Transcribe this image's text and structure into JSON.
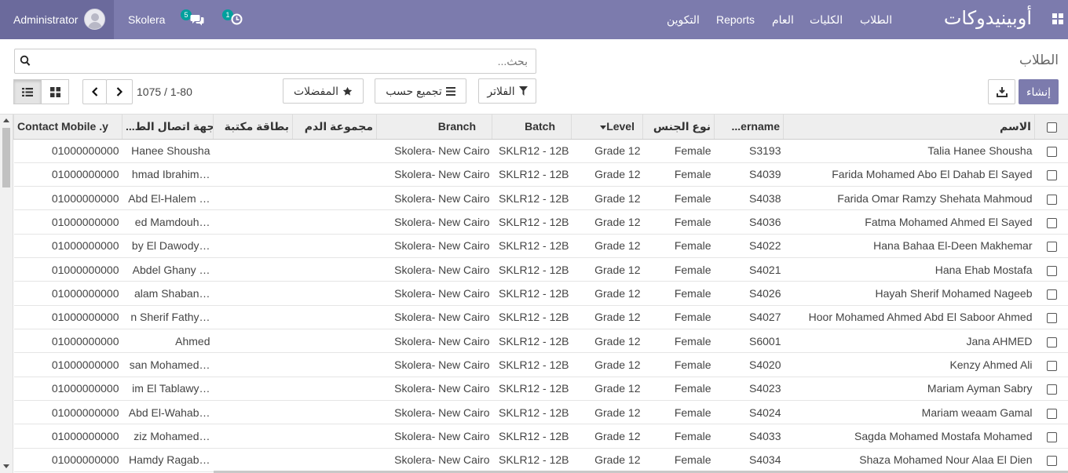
{
  "navbar": {
    "user": "Administrator",
    "company": "Skolera",
    "messages_count": "5",
    "activities_count": "1",
    "menu": [
      "التكوين",
      "Reports",
      "العام",
      "الكليات",
      "الطلاب"
    ],
    "brand": "أوبينيدوكات"
  },
  "control_panel": {
    "title": "الطلاب",
    "search_placeholder": "بحث...",
    "create_label": "إنشاء",
    "filters_label": "الفلاتر",
    "group_by_label": "تجميع حسب",
    "favorites_label": "المفضلات",
    "pager_value": "1-80",
    "pager_sep": "/",
    "pager_total": "1075"
  },
  "table": {
    "columns": {
      "name": "الاسم",
      "username": "...ername",
      "gender": "نوع الجنس",
      "level": "Level",
      "batch": "Batch",
      "branch": "Branch",
      "blood_group": "مجموعة الدم",
      "library_card": "بطاقة مكتبة",
      "emergency_contact": "...جهة اتصال الط",
      "emergency_mobile": "Contact Mobile .y"
    },
    "rows": [
      {
        "name": "Talia Hanee Shousha",
        "username": "S3193",
        "gender": "Female",
        "level": "Grade 12",
        "batch": "SKLR12 - 12B",
        "branch": "Skolera- New Cairo",
        "contact": "Hanee Shousha",
        "mobile": "01000000000"
      },
      {
        "name": "Farida Mohamed Abo El Dahab El Sayed",
        "username": "S4039",
        "gender": "Female",
        "level": "Grade 12",
        "batch": "SKLR12 - 12B",
        "branch": "Skolera- New Cairo",
        "contact": "hmad Ibrahim…",
        "mobile": "01000000000"
      },
      {
        "name": "Farida Omar Ramzy Shehata Mahmoud",
        "username": "S4038",
        "gender": "Female",
        "level": "Grade 12",
        "batch": "SKLR12 - 12B",
        "branch": "Skolera- New Cairo",
        "contact": "Abd El-Halem …",
        "mobile": "01000000000"
      },
      {
        "name": "Fatma Mohamed Ahmed El Sayed",
        "username": "S4036",
        "gender": "Female",
        "level": "Grade 12",
        "batch": "SKLR12 - 12B",
        "branch": "Skolera- New Cairo",
        "contact": "ed Mamdouh…",
        "mobile": "01000000000"
      },
      {
        "name": "Hana Bahaa El-Deen Makhemar",
        "username": "S4022",
        "gender": "Female",
        "level": "Grade 12",
        "batch": "SKLR12 - 12B",
        "branch": "Skolera- New Cairo",
        "contact": "by El Dawody…",
        "mobile": "01000000000"
      },
      {
        "name": "Hana Ehab Mostafa",
        "username": "S4021",
        "gender": "Female",
        "level": "Grade 12",
        "batch": "SKLR12 - 12B",
        "branch": "Skolera- New Cairo",
        "contact": "Abdel Ghany …",
        "mobile": "01000000000"
      },
      {
        "name": "Hayah Sherif Mohamed Nageeb",
        "username": "S4026",
        "gender": "Female",
        "level": "Grade 12",
        "batch": "SKLR12 - 12B",
        "branch": "Skolera- New Cairo",
        "contact": "alam Shaban…",
        "mobile": "01000000000"
      },
      {
        "name": "Hoor Mohamed Ahmed Abd El Saboor Ahmed",
        "username": "S4027",
        "gender": "Female",
        "level": "Grade 12",
        "batch": "SKLR12 - 12B",
        "branch": "Skolera- New Cairo",
        "contact": "n Sherif Fathy…",
        "mobile": "01000000000"
      },
      {
        "name": "Jana AHMED",
        "username": "S6001",
        "gender": "Female",
        "level": "Grade 12",
        "batch": "SKLR12 - 12B",
        "branch": "Skolera- New Cairo",
        "contact": "Ahmed",
        "mobile": "01000000000"
      },
      {
        "name": "Kenzy Ahmed Ali",
        "username": "S4020",
        "gender": "Female",
        "level": "Grade 12",
        "batch": "SKLR12 - 12B",
        "branch": "Skolera- New Cairo",
        "contact": "san Mohamed…",
        "mobile": "01000000000"
      },
      {
        "name": "Mariam Ayman Sabry",
        "username": "S4023",
        "gender": "Female",
        "level": "Grade 12",
        "batch": "SKLR12 - 12B",
        "branch": "Skolera- New Cairo",
        "contact": "im El Tablawy…",
        "mobile": "01000000000"
      },
      {
        "name": "Mariam weaam Gamal",
        "username": "S4024",
        "gender": "Female",
        "level": "Grade 12",
        "batch": "SKLR12 - 12B",
        "branch": "Skolera- New Cairo",
        "contact": "Abd El-Wahab…",
        "mobile": "01000000000"
      },
      {
        "name": "Sagda Mohamed Mostafa Mohamed",
        "username": "S4033",
        "gender": "Female",
        "level": "Grade 12",
        "batch": "SKLR12 - 12B",
        "branch": "Skolera- New Cairo",
        "contact": "ziz Mohamed…",
        "mobile": "01000000000"
      },
      {
        "name": "Shaza Mohamed Nour Alaa El Dien",
        "username": "S4034",
        "gender": "Female",
        "level": "Grade 12",
        "batch": "SKLR12 - 12B",
        "branch": "Skolera- New Cairo",
        "contact": "Hamdy Ragab…",
        "mobile": "01000000000"
      }
    ]
  }
}
